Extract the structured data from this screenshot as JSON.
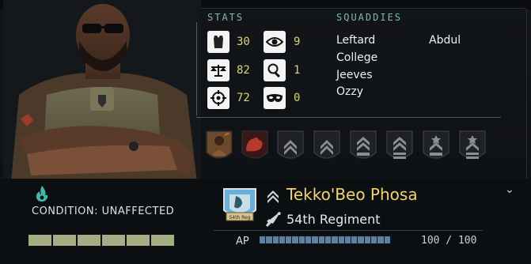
{
  "panel": {
    "stats_title": "STATS",
    "squaddies_title": "SQUADDIES"
  },
  "stats": [
    {
      "icon": "armor-vest-icon",
      "value": "30"
    },
    {
      "icon": "eye-icon",
      "value": "9"
    },
    {
      "icon": "balance-scale-icon",
      "value": "82"
    },
    {
      "icon": "magnifier-icon",
      "value": "1"
    },
    {
      "icon": "crosshair-icon",
      "value": "72"
    },
    {
      "icon": "mask-icon",
      "value": "0"
    }
  ],
  "squaddies": [
    "Leftard",
    "Abdul",
    "College",
    "Jeeves",
    "Ozzy"
  ],
  "condition": {
    "label": "CONDITION: UNAFFECTED",
    "icon": "flame-icon",
    "hp_segments_filled": 6,
    "hp_segments_total": 6
  },
  "soldier": {
    "name": "Tekko'Beo Phosa",
    "regiment": "54th Regiment",
    "emblem_text": "54th Reg"
  },
  "ap": {
    "label": "AP",
    "value_text": "100 / 100",
    "fraction": 1.0
  },
  "colors": {
    "name": "#f2d46a",
    "stat_value": "#e0d66a",
    "title": "#7fb9b9",
    "ap": "#5d7fa0",
    "hp": "#a7ad82",
    "condition_icon": "#3fb9a8"
  }
}
